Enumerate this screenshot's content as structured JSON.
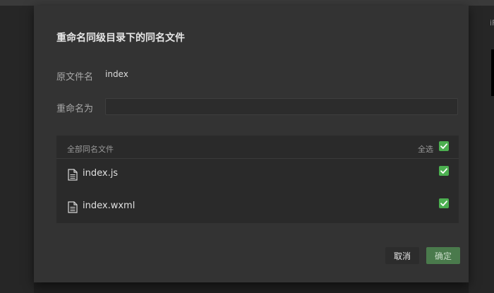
{
  "dialog": {
    "title": "重命名同级目录下的同名文件",
    "original_label": "原文件名",
    "original_value": "index",
    "rename_label": "重命名为",
    "rename_value": "",
    "rename_placeholder": ""
  },
  "file_list": {
    "header": "全部同名文件",
    "select_all_label": "全选",
    "select_all_checked": true,
    "files": [
      {
        "name": "index.js",
        "checked": true
      },
      {
        "name": "index.wxml",
        "checked": true
      }
    ]
  },
  "buttons": {
    "cancel": "取消",
    "confirm": "确定"
  },
  "background": {
    "edge_text": "iF"
  },
  "colors": {
    "accent_green": "#4caf50",
    "confirm_green": "#4a7a4c"
  }
}
